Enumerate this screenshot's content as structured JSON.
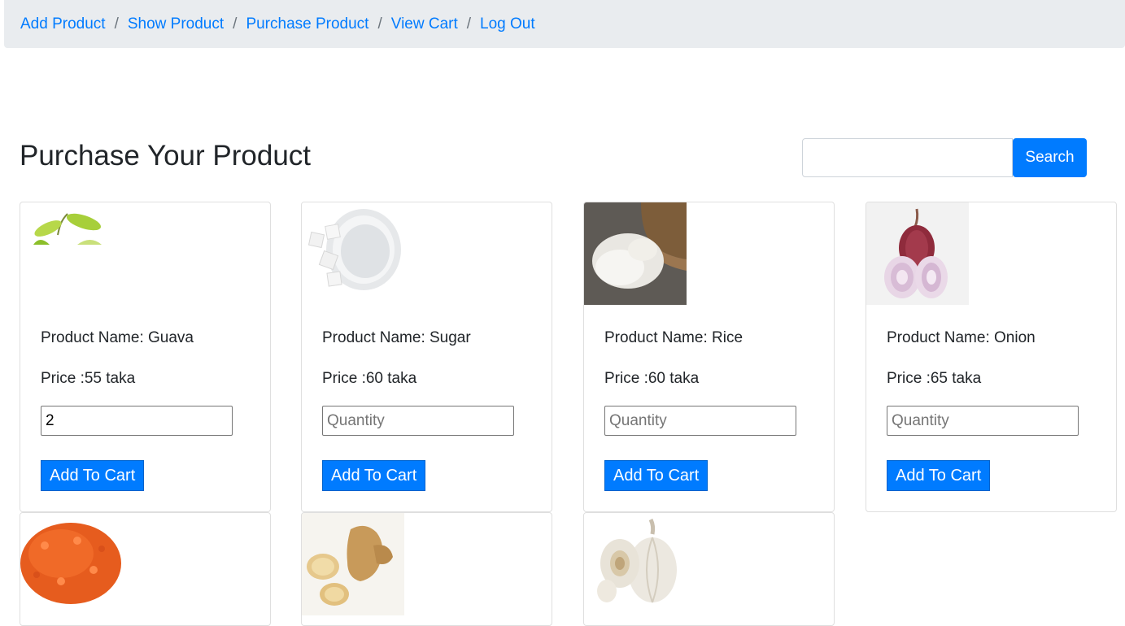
{
  "nav": {
    "items": [
      "Add Product",
      "Show Product",
      "Purchase Product",
      "View Cart",
      "Log Out"
    ],
    "separator": "/"
  },
  "page": {
    "title": "Purchase Your Product"
  },
  "search": {
    "value": "",
    "button_label": "Search"
  },
  "products": [
    {
      "name": "Product Name: Guava",
      "price": "Price :55 taka",
      "quantity": "2",
      "quantity_placeholder": "Quantity",
      "button_label": "Add To Cart",
      "image": "guava"
    },
    {
      "name": "Product Name: Sugar",
      "price": "Price :60 taka",
      "quantity": "",
      "quantity_placeholder": "Quantity",
      "button_label": "Add To Cart",
      "image": "sugar"
    },
    {
      "name": "Product Name: Rice",
      "price": "Price :60 taka",
      "quantity": "",
      "quantity_placeholder": "Quantity",
      "button_label": "Add To Cart",
      "image": "rice"
    },
    {
      "name": "Product Name: Onion",
      "price": "Price :65 taka",
      "quantity": "",
      "quantity_placeholder": "Quantity",
      "button_label": "Add To Cart",
      "image": "onion"
    },
    {
      "image": "lentils"
    },
    {
      "image": "ginger"
    },
    {
      "image": "garlic"
    }
  ],
  "colors": {
    "primary": "#007bff",
    "breadcrumb_bg": "#e9ecef"
  }
}
